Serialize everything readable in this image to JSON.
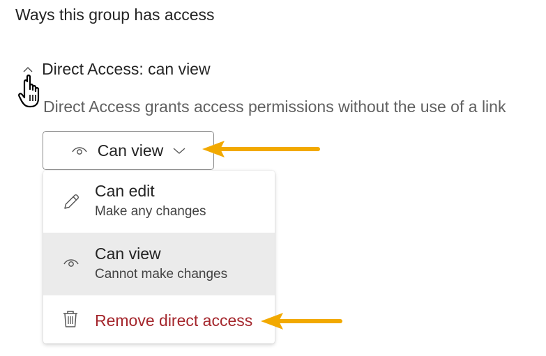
{
  "heading": "Ways this group has access",
  "section": {
    "title": "Direct Access: can view",
    "description": "Direct Access grants access permissions without the use of a link"
  },
  "dropdown": {
    "selected": "Can view"
  },
  "menu": {
    "items": [
      {
        "title": "Can edit",
        "subtitle": "Make any changes",
        "icon": "pencil-icon"
      },
      {
        "title": "Can view",
        "subtitle": "Cannot make changes",
        "icon": "eye-icon"
      },
      {
        "title": "Remove direct access",
        "icon": "trash-icon"
      }
    ]
  },
  "colors": {
    "accent_arrow": "#f2a900",
    "remove_text": "#a4262c",
    "selected_bg": "#ebebeb"
  }
}
